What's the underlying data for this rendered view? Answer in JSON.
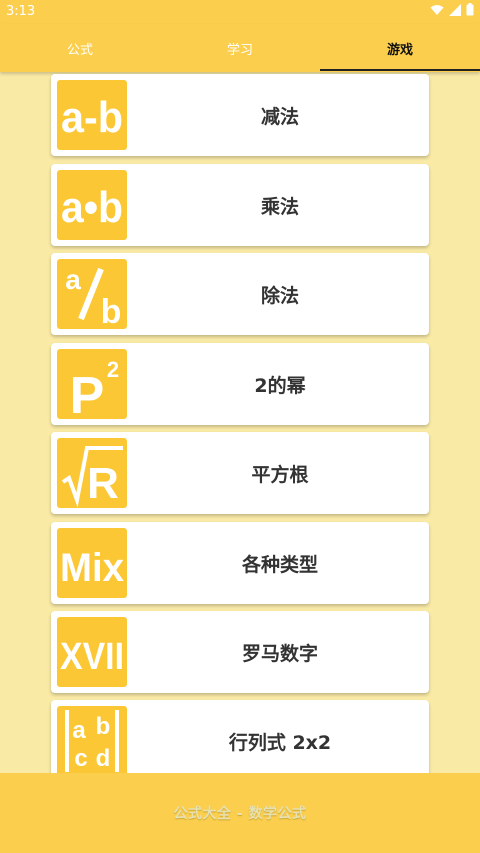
{
  "status_bar": {
    "time": "3:13",
    "icons": [
      "wifi-icon",
      "signal-icon",
      "battery-icon"
    ]
  },
  "tabs": [
    {
      "label": "公式",
      "active": false
    },
    {
      "label": "学习",
      "active": false
    },
    {
      "label": "游戏",
      "active": true
    }
  ],
  "games": [
    {
      "label": "减法",
      "icon": "subtraction-icon",
      "icon_text": "a-b"
    },
    {
      "label": "乘法",
      "icon": "multiplication-icon",
      "icon_text": "a•b"
    },
    {
      "label": "除法",
      "icon": "division-icon",
      "icon_text": "a/b"
    },
    {
      "label": "2的幂",
      "icon": "power-of-two-icon",
      "icon_text": "P2"
    },
    {
      "label": "平方根",
      "icon": "square-root-icon",
      "icon_text": "√R"
    },
    {
      "label": "各种类型",
      "icon": "mix-icon",
      "icon_text": "Mix"
    },
    {
      "label": "罗马数字",
      "icon": "roman-numerals-icon",
      "icon_text": "XVII"
    },
    {
      "label": "行列式 2x2",
      "icon": "determinant-icon",
      "icon_text": "|a b c d|"
    }
  ],
  "footer": {
    "text": "公式大全 - 数学公式"
  },
  "colors": {
    "primary": "#fbcf4d",
    "background": "#f9eaa6",
    "icon_bg": "#fbc734",
    "card": "#ffffff"
  }
}
